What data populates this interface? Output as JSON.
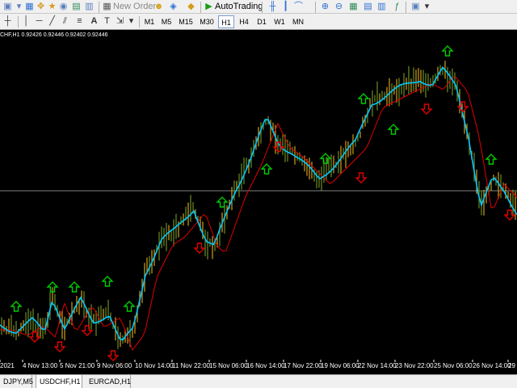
{
  "toolbar": {
    "new_order_label": "New Order",
    "autotrading_label": "AutoTrading",
    "autotrading_color": "#1a9e1a"
  },
  "timeframes": [
    "M1",
    "M5",
    "M15",
    "M30",
    "H1",
    "H4",
    "D1",
    "W1",
    "MN"
  ],
  "active_timeframe": "H1",
  "chart": {
    "symbol_line": "CHF,H1  0.92426 0.92446 0.92402 0.92446",
    "background": "#000000",
    "bull_bar_color": "#d4a017",
    "bear_bar_color": "#6b8e23",
    "fast_ma_color": "#00c8ff",
    "slow_ma_color": "#e00000",
    "up_arrow_color": "#00cc00",
    "down_arrow_color": "#e00000",
    "level_line_color": "#808080",
    "x_labels": [
      "2021",
      "4 Nov 13:00",
      "5 Nov 21:00",
      "9 Nov 06:00",
      "10 Nov 14:00",
      "11 Nov 22:00",
      "15 Nov 06:00",
      "16 Nov 14:00",
      "17 Nov 22:00",
      "19 Nov 06:00",
      "22 Nov 14:00",
      "23 Nov 22:00",
      "25 Nov 06:00",
      "26 Nov 14:00",
      "29"
    ]
  },
  "symbol_tabs": [
    "DJPY,M5",
    "USDCHF,H1",
    "EURCAD,H1"
  ],
  "active_symbol_tab": "USDCHF,H1"
}
